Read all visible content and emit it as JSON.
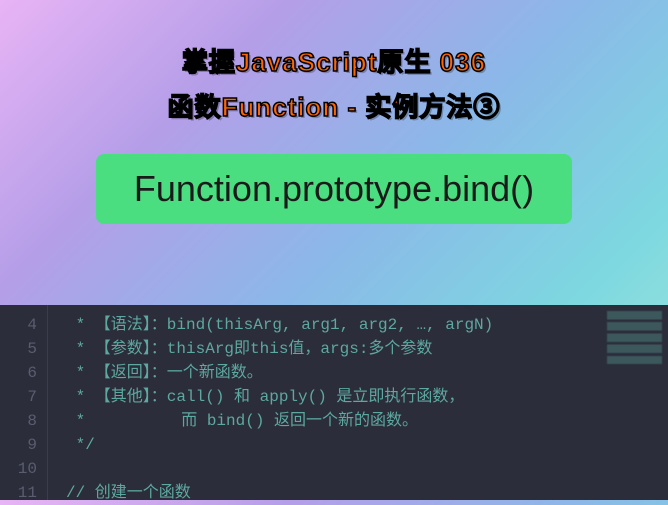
{
  "header": {
    "title_line1": "掌握JavaScript原生 036",
    "title_line2": "函数Function - 实例方法③"
  },
  "banner": {
    "text": "Function.prototype.bind()"
  },
  "editor": {
    "line_start": 4,
    "lines": [
      {
        "n": 4,
        "cm": " * 【语法】：bind(thisArg, arg1, arg2, …, argN)"
      },
      {
        "n": 5,
        "cm": " * 【参数】：thisArg即this值，args:多个参数"
      },
      {
        "n": 6,
        "cm": " * 【返回】：一个新函数。"
      },
      {
        "n": 7,
        "cm": " * 【其他】：call() 和 apply() 是立即执行函数，"
      },
      {
        "n": 8,
        "cm": " *          而 bind() 返回一个新的函数。"
      },
      {
        "n": 9,
        "cm": " */"
      },
      {
        "n": 10,
        "cm": ""
      },
      {
        "n": 11,
        "cm": "// 创建一个函数"
      }
    ]
  }
}
